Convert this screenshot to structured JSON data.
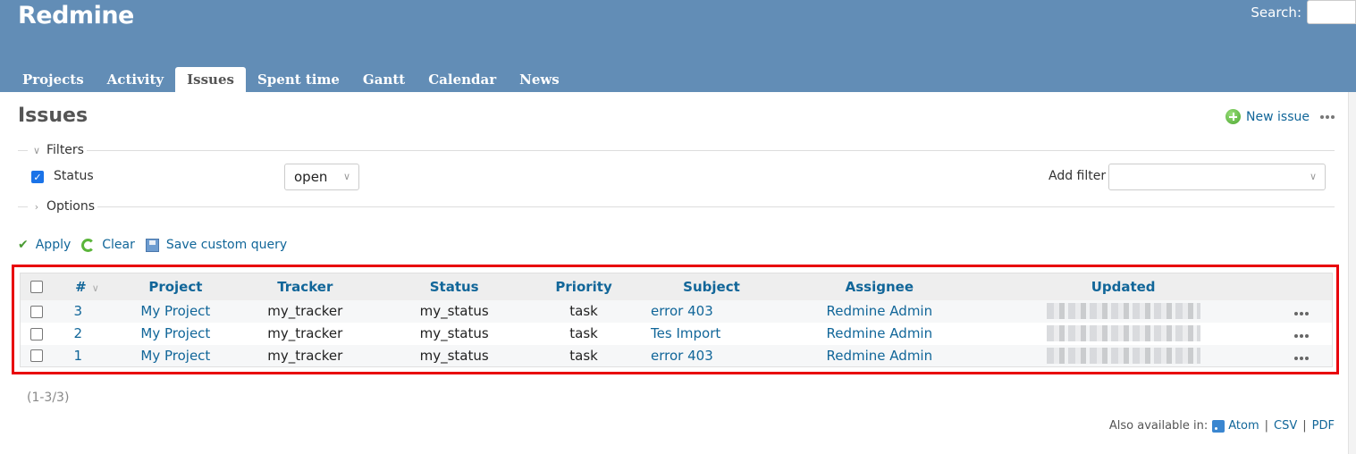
{
  "header": {
    "app_title": "Redmine",
    "search_label": "Search:",
    "search_value": "",
    "menu": [
      {
        "label": "Projects",
        "selected": false
      },
      {
        "label": "Activity",
        "selected": false
      },
      {
        "label": "Issues",
        "selected": true
      },
      {
        "label": "Spent time",
        "selected": false
      },
      {
        "label": "Gantt",
        "selected": false
      },
      {
        "label": "Calendar",
        "selected": false
      },
      {
        "label": "News",
        "selected": false
      }
    ]
  },
  "page": {
    "title": "Issues",
    "new_issue_label": "New issue",
    "more_icon": "ellipsis-icon"
  },
  "filters": {
    "legend": "Filters",
    "status_label": "Status",
    "status_checked": true,
    "status_operator": "open",
    "add_filter_label": "Add filter",
    "add_filter_value": ""
  },
  "options": {
    "legend": "Options"
  },
  "query_buttons": {
    "apply": "Apply",
    "clear": "Clear",
    "save": "Save custom query"
  },
  "table": {
    "columns": [
      "#",
      "Project",
      "Tracker",
      "Status",
      "Priority",
      "Subject",
      "Assignee",
      "Updated"
    ],
    "sort_column": "#",
    "rows": [
      {
        "id": "3",
        "project": "My Project",
        "tracker": "my_tracker",
        "status": "my_status",
        "priority": "task",
        "subject": "error 403",
        "assignee": "Redmine Admin",
        "updated": "[redacted]"
      },
      {
        "id": "2",
        "project": "My Project",
        "tracker": "my_tracker",
        "status": "my_status",
        "priority": "task",
        "subject": "Tes Import",
        "assignee": "Redmine Admin",
        "updated": "[redacted]"
      },
      {
        "id": "1",
        "project": "My Project",
        "tracker": "my_tracker",
        "status": "my_status",
        "priority": "task",
        "subject": "error 403",
        "assignee": "Redmine Admin",
        "updated": "[redacted]"
      }
    ]
  },
  "pagination": "(1-3/3)",
  "other_formats": {
    "label": "Also available in:",
    "atom": "Atom",
    "csv": "CSV",
    "pdf": "PDF",
    "separator": "|"
  },
  "colors": {
    "header_bg": "#628db6",
    "link": "#116699",
    "highlight_border": "#e8000b"
  }
}
